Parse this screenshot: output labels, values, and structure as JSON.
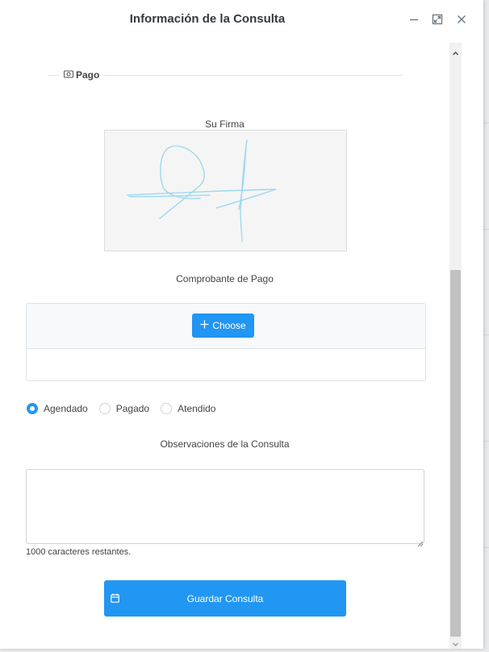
{
  "dialog": {
    "title": "Información de la Consulta"
  },
  "payment": {
    "legend": "Pago",
    "signature_label": "Su Firma",
    "receipt_label": "Comprobante de Pago",
    "choose_label": "Choose"
  },
  "status": {
    "options": [
      "Agendado",
      "Pagado",
      "Atendido"
    ],
    "selected": "Agendado"
  },
  "observations": {
    "label": "Observaciones de la Consulta",
    "value": "",
    "remaining": "1000 caracteres restantes."
  },
  "save_button": {
    "label": "Guardar Consulta"
  },
  "colors": {
    "accent": "#2196f3",
    "signature_ink": "#9ed8f0"
  },
  "icons": {
    "legend": "money-icon",
    "choose": "plus-icon",
    "save": "calendar-icon",
    "header": [
      "minimize-icon",
      "maximize-icon",
      "close-icon"
    ]
  }
}
